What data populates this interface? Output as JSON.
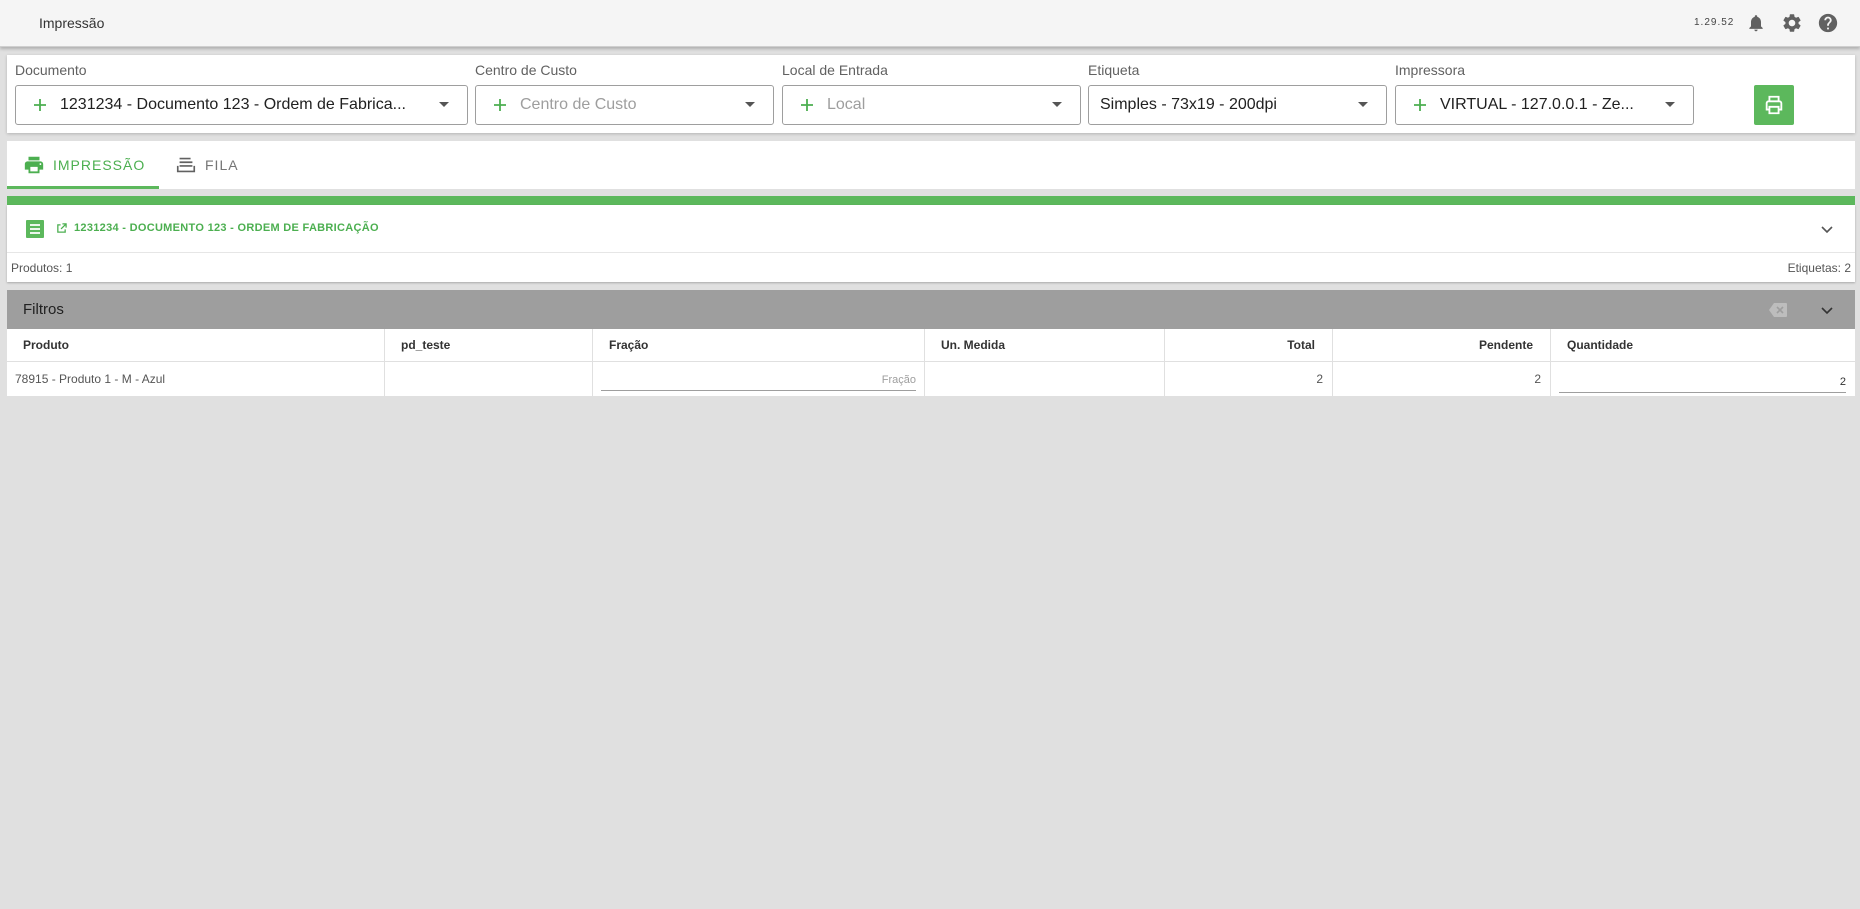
{
  "app": {
    "title": "Impressão",
    "version": "1.29.52"
  },
  "form": {
    "documento": {
      "label": "Documento",
      "value": "1231234 - Documento 123 - Ordem de Fabrica..."
    },
    "centro_custo": {
      "label": "Centro de Custo",
      "placeholder": "Centro de Custo"
    },
    "local_entrada": {
      "label": "Local de Entrada",
      "placeholder": "Local"
    },
    "etiqueta": {
      "label": "Etiqueta",
      "value": "Simples - 73x19 - 200dpi"
    },
    "impressora": {
      "label": "Impressora",
      "value": "VIRTUAL - 127.0.0.1 - Ze..."
    }
  },
  "tabs": [
    {
      "label": "IMPRESSÃO",
      "icon": "printer-icon",
      "active": true
    },
    {
      "label": "FILA",
      "icon": "queue-icon",
      "active": false
    }
  ],
  "document_panel": {
    "title": "1231234 - DOCUMENTO 123 - ORDEM DE FABRICAÇÃO",
    "produtos_label": "Produtos:",
    "produtos_value": "1",
    "etiquetas_label": "Etiquetas:",
    "etiquetas_value": "2"
  },
  "filters": {
    "title": "Filtros"
  },
  "table": {
    "columns": [
      "Produto",
      "pd_teste",
      "Fração",
      "Un. Medida",
      "Total",
      "Pendente",
      "Quantidade"
    ],
    "rows": [
      {
        "produto": "78915 - Produto 1 - M - Azul",
        "pd_teste": "",
        "fracao_placeholder": "Fração",
        "un_medida": "",
        "total": "2",
        "pendente": "2",
        "quantidade": "2"
      }
    ]
  },
  "colors": {
    "accent": "#5cb85c",
    "accent_text": "#4caf50",
    "filters_bar": "#9e9e9e",
    "background": "#e0e0e0"
  }
}
